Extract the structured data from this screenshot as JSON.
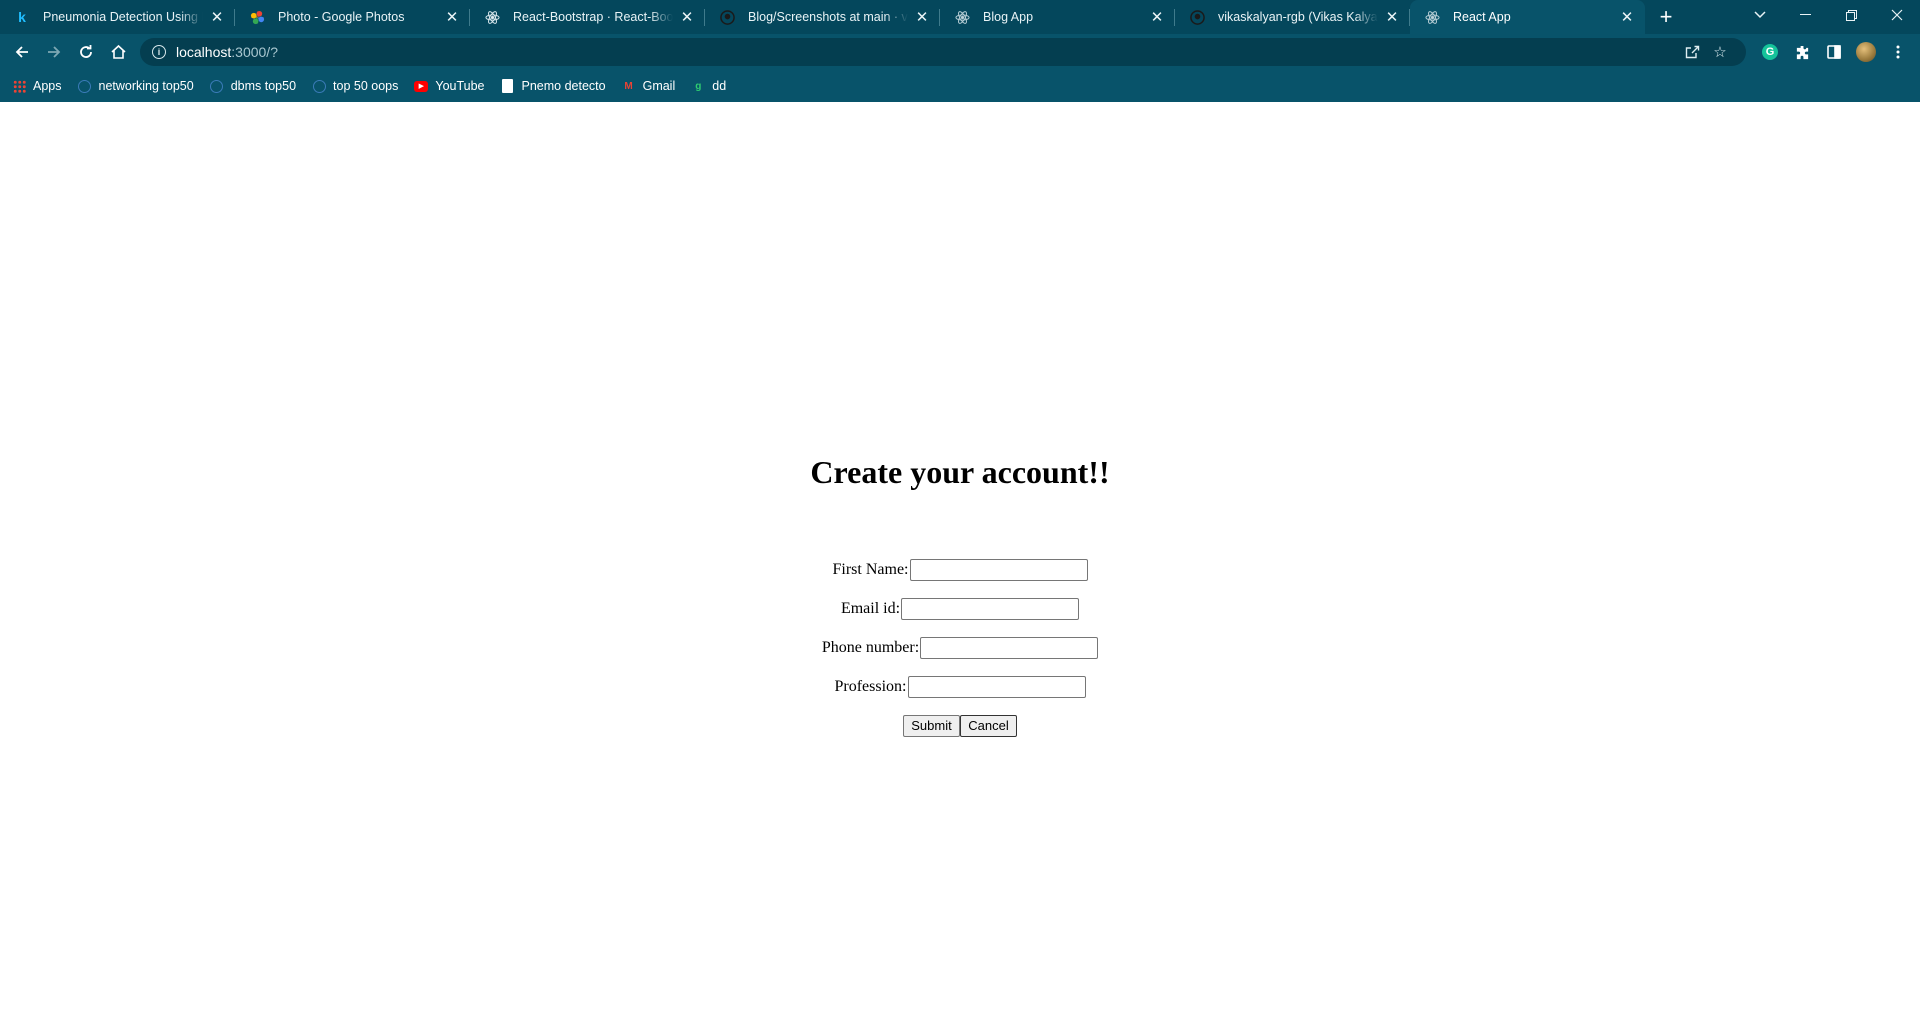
{
  "browser": {
    "tabs": [
      {
        "title": "Pneumonia Detection Using Fast",
        "icon": "kaggle-k-icon",
        "active": false
      },
      {
        "title": "Photo - Google Photos",
        "icon": "google-photos-icon",
        "active": false
      },
      {
        "title": "React-Bootstrap · React-Bootstrap",
        "icon": "react-icon",
        "active": false
      },
      {
        "title": "Blog/Screenshots at main · vikas",
        "icon": "github-icon",
        "active": false
      },
      {
        "title": "Blog App",
        "icon": "react-icon",
        "active": false
      },
      {
        "title": "vikaskalyan-rgb (Vikas Kalyan)",
        "icon": "github-icon",
        "active": false
      },
      {
        "title": "React App",
        "icon": "react-icon",
        "active": true
      }
    ],
    "address": {
      "host": "localhost",
      "path": ":3000/?"
    },
    "bookmarks": [
      {
        "label": "Apps",
        "icon": "apps-grid-icon"
      },
      {
        "label": "networking top50",
        "icon": "globe-icon"
      },
      {
        "label": "dbms top50",
        "icon": "globe-icon"
      },
      {
        "label": "top 50 oops",
        "icon": "globe-icon"
      },
      {
        "label": "YouTube",
        "icon": "youtube-icon"
      },
      {
        "label": "Pnemo detecto",
        "icon": "document-icon"
      },
      {
        "label": "Gmail",
        "icon": "gmail-icon"
      },
      {
        "label": "dd",
        "icon": "dd-icon"
      }
    ],
    "colors": {
      "frame": "#04475c",
      "toolbar": "#08536a",
      "omnibox": "#043e50"
    }
  },
  "page": {
    "heading": "Create your account!!",
    "fields": [
      {
        "label": "First Name:",
        "value": ""
      },
      {
        "label": "Email id:",
        "value": ""
      },
      {
        "label": "Phone number:",
        "value": ""
      },
      {
        "label": "Profession:",
        "value": ""
      }
    ],
    "submit_label": "Submit",
    "cancel_label": "Cancel"
  }
}
